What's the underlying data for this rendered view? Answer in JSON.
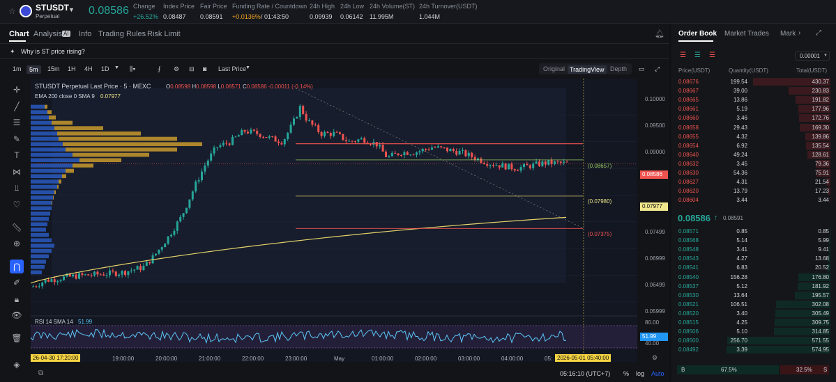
{
  "header": {
    "symbol": "STUSDT",
    "sub": "Perpetual",
    "price": "0.08586",
    "stats": [
      {
        "label": "Change",
        "value": "+26.52%",
        "color": "#26a69a"
      },
      {
        "label": "Index Price",
        "value": "0.08487"
      },
      {
        "label": "Fair Price",
        "value": "0.08591"
      },
      {
        "label": "Funding Rate / Countdown",
        "value": "+0.0136%",
        "value2": "/ 01:43:50",
        "color": "#f5a623"
      },
      {
        "label": "24h High",
        "value": "0.09939"
      },
      {
        "label": "24h Low",
        "value": "0.06142"
      },
      {
        "label": "24h Volume(ST)",
        "value": "11.995M"
      },
      {
        "label": "24h Turnover(USDT)",
        "value": "1.044M"
      }
    ]
  },
  "tabs": {
    "chart": "Chart",
    "analysis": "Analysis",
    "ai": "AI",
    "info": "Info",
    "rules": "Trading Rules",
    "risk": "Risk Limit"
  },
  "banner": "Why is ST price rising?",
  "toolbar": {
    "intervals": [
      "1m",
      "5m",
      "15m",
      "1H",
      "4H",
      "1D"
    ],
    "last_price": "Last Price",
    "views": [
      "Original",
      "TradingView",
      "Depth"
    ]
  },
  "chart": {
    "legend": "STUSDT Perpetual Last Price · 5 · MEXC",
    "o": "O",
    "oval": "0.08598",
    "h": "H",
    "hval": "0.08598",
    "l": "L",
    "lval": "0.08571",
    "c": "C",
    "cval": "0.08586",
    "chg": "-0.00011 (-0.14%)",
    "ema": "EMA 200 close 0 SMA 9",
    "emaval": "0.07977",
    "rsi": "RSI 14 SMA 14",
    "rsival": "51.99",
    "rsi_badge": "51.99",
    "price_labels": [
      "0.10000",
      "0.09500",
      "0.09000",
      "0.08497",
      "0.07499",
      "0.06999",
      "0.06499",
      "0.05999"
    ],
    "line_labels": [
      "(0.08657)",
      "(0.07980)",
      "(0.07375)"
    ],
    "badge_price": "0.08586",
    "badge_ema": "0.07977",
    "rsi_labels": [
      "80.00",
      "40.00"
    ],
    "time_labels": [
      "19:00:00",
      "20:00:00",
      "21:00:00",
      "22:00:00",
      "23:00:00",
      "May",
      "01:00:00",
      "02:00:00",
      "03:00:00",
      "04:00:00",
      "05:"
    ],
    "time_start": "26-04-30  17:20:00",
    "time_end": "2026-05-01  05:40:00",
    "clock": "05:16:10 (UTC+7)",
    "pct": "%",
    "log": "log",
    "auto": "Auto"
  },
  "chart_data": {
    "type": "candlestick",
    "title": "STUSDT Perpetual Last Price · 5 · MEXC",
    "last": 0.08586,
    "ema200": 0.07977,
    "ylim": [
      0.0575,
      0.1005
    ],
    "rsi": 51.99,
    "lines": [
      {
        "value": 0.08657
      },
      {
        "value": 0.0798
      },
      {
        "value": 0.07375
      },
      {
        "value": 0.0896
      }
    ]
  },
  "orderbook": {
    "tabs": [
      "Order Book",
      "Market Trades",
      "Mark"
    ],
    "precision": "0.00001",
    "headers": [
      "Price(USDT)",
      "Quantity(USDT)",
      "Total(USDT)"
    ],
    "asks": [
      [
        "0.08676",
        "199.54",
        "430.37"
      ],
      [
        "0.08667",
        "39.00",
        "230.83"
      ],
      [
        "0.08665",
        "13.86",
        "191.82"
      ],
      [
        "0.08661",
        "5.19",
        "177.96"
      ],
      [
        "0.08660",
        "3.46",
        "172.76"
      ],
      [
        "0.08658",
        "29.43",
        "169.30"
      ],
      [
        "0.08655",
        "4.32",
        "139.86"
      ],
      [
        "0.08654",
        "6.92",
        "135.54"
      ],
      [
        "0.08640",
        "49.24",
        "128.61"
      ],
      [
        "0.08632",
        "3.45",
        "79.36"
      ],
      [
        "0.08630",
        "54.36",
        "75.91"
      ],
      [
        "0.08627",
        "4.31",
        "21.54"
      ],
      [
        "0.08620",
        "13.79",
        "17.23"
      ],
      [
        "0.08604",
        "3.44",
        "3.44"
      ]
    ],
    "mid": "0.08586",
    "mid_arrow": "↑",
    "mid_fair": "0.08591",
    "bids": [
      [
        "0.08571",
        "0.85",
        "0.85"
      ],
      [
        "0.08568",
        "5.14",
        "5.99"
      ],
      [
        "0.08548",
        "3.41",
        "9.41"
      ],
      [
        "0.08543",
        "4.27",
        "13.68"
      ],
      [
        "0.08541",
        "6.83",
        "20.52"
      ],
      [
        "0.08540",
        "156.28",
        "176.80"
      ],
      [
        "0.08537",
        "5.12",
        "181.92"
      ],
      [
        "0.08530",
        "13.64",
        "195.57"
      ],
      [
        "0.08521",
        "106.51",
        "302.08"
      ],
      [
        "0.08520",
        "3.40",
        "305.49"
      ],
      [
        "0.08515",
        "4.25",
        "309.75"
      ],
      [
        "0.08506",
        "5.10",
        "314.85"
      ],
      [
        "0.08500",
        "256.70",
        "571.55"
      ],
      [
        "0.08492",
        "3.39",
        "574.95"
      ]
    ],
    "buy_label": "B",
    "buy_pct": "67.5%",
    "sell_pct": "32.5%",
    "sell_label": "S"
  }
}
